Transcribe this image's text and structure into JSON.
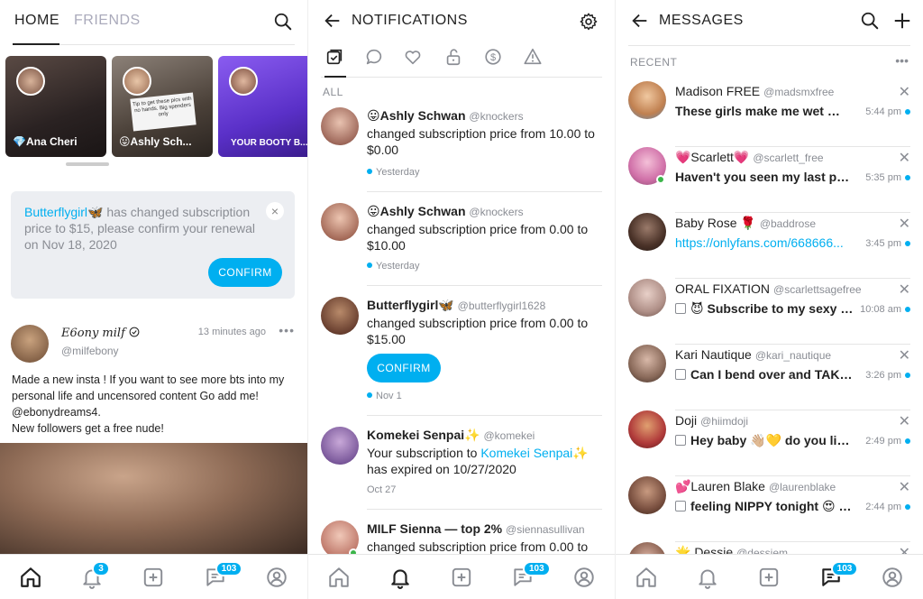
{
  "colors": {
    "accent": "#00aff0",
    "online": "#3cb54a",
    "muted": "#8a8d94"
  },
  "home": {
    "tabs": [
      "HOME",
      "FRIENDS"
    ],
    "stories": [
      {
        "label": "💎Ana Cheri"
      },
      {
        "label": "😛Ashly Sch..."
      },
      {
        "label": "YOUR BOOTY B..."
      }
    ],
    "story_overlay_text": "Tip to get these pics with no hands. Big spenders only",
    "notice": {
      "link": "Butterflygirl🦋",
      "text": " has changed subscription price to $15, please confirm your renewal on Nov 18, 2020",
      "close": "×",
      "button": "CONFIRM"
    },
    "post": {
      "name": "E6ony milf",
      "handle": "@milfebony",
      "time": "13 minutes ago",
      "more": "•••",
      "body": "Made a new insta ! If you want to see more bts into my personal life and uncensored content Go add me! @ebonydreams4.\nNew followers get a free nude!"
    }
  },
  "notifications": {
    "title": "NOTIFICATIONS",
    "filter_label": "ALL",
    "items": [
      {
        "name": "😛Ashly Schwan",
        "handle": "@knockers",
        "text": "changed subscription price from 10.00 to $0.00",
        "date": "Yesterday",
        "unread": true
      },
      {
        "name": "😛Ashly Schwan",
        "handle": "@knockers",
        "text": "changed subscription price from 0.00 to $10.00",
        "date": "Yesterday",
        "unread": true
      },
      {
        "name": "Butterflygirl🦋",
        "handle": "@butterflygirl1628",
        "text": "changed subscription price from 0.00 to $15.00",
        "button": "CONFIRM",
        "date": "Nov 1",
        "unread": true
      },
      {
        "name": "Komekei Senpai✨",
        "handle": "@komekei",
        "text_pre": "Your subscription to ",
        "text_link": "Komekei Senpai✨",
        "text_post": " has expired on 10/27/2020",
        "date": "Oct 27",
        "unread": false
      },
      {
        "name": "MILF Sienna — top 2%",
        "handle": "@siennasullivan",
        "text": "changed subscription price from 0.00 to",
        "date": "",
        "unread": false
      }
    ]
  },
  "messages": {
    "title": "MESSAGES",
    "section": "RECENT",
    "more": "•••",
    "items": [
      {
        "name": "Madison FREE",
        "handle": "@madsmxfree",
        "text": "These girls make me wet 👅 !!...",
        "time": "5:44 pm"
      },
      {
        "name": "💗Scarlett💗",
        "handle": "@scarlett_free",
        "text": "Haven't you seen my last post ...",
        "time": "5:35 pm"
      },
      {
        "name": "Baby Rose 🌹",
        "handle": "@baddrose",
        "text": "https://onlyfans.com/668666...",
        "time": "3:45 pm"
      },
      {
        "name": "ORAL FIXATION",
        "handle": "@scarlettsagefree",
        "text": "😈 Subscribe to my sexy s...",
        "time": "10:08 am"
      },
      {
        "name": "Kari Nautique",
        "handle": "@kari_nautique",
        "text": "Can I bend over and TAKE ...",
        "time": "3:26 pm"
      },
      {
        "name": "Doji",
        "handle": "@hiimdoji",
        "text": "Hey baby 👋🏼💛 do you like ...",
        "time": "2:49 pm"
      },
      {
        "name": "💕Lauren Blake",
        "handle": "@laurenblake",
        "text": "feeling NIPPY tonight 😍 m...",
        "time": "2:44 pm"
      },
      {
        "name": "🌟 Dessie",
        "handle": "@dessiem",
        "text": "",
        "time": ""
      }
    ]
  },
  "tabbar": {
    "notifications_badge": "3",
    "messages_badge": "103"
  }
}
